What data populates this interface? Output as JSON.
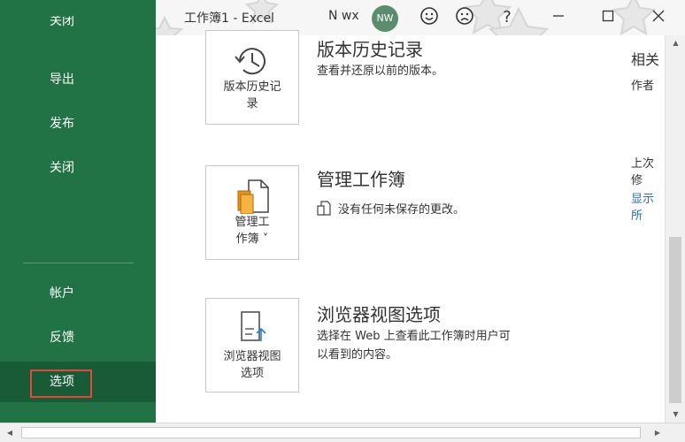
{
  "window": {
    "title": "工作簿1  -  Excel",
    "user_name": "N wx",
    "avatar_initials": "NW",
    "icons": [
      "smile-icon",
      "frown-icon",
      "help-icon",
      "minimize-icon",
      "maximize-icon",
      "close-icon"
    ],
    "help_label": "?"
  },
  "sidebar": {
    "partial_item": "关闭",
    "items": [
      {
        "label": "导出"
      },
      {
        "label": "发布"
      },
      {
        "label": "关闭"
      },
      {
        "label": "帐户"
      },
      {
        "label": "反馈"
      },
      {
        "label": "选项"
      }
    ],
    "accent": "#217346",
    "selected_bg": "#195a37",
    "highlight_box_color": "#e04a3a"
  },
  "main": {
    "sections": [
      {
        "card_label_1": "版本历史记",
        "card_label_2": "录",
        "title": "版本历史记录",
        "desc": "查看并还原以前的版本。"
      },
      {
        "card_label_1": "管理工",
        "card_label_2": "作簿 ˅",
        "title": "管理工作簿",
        "desc": "没有任何未保存的更改。"
      },
      {
        "card_label_1": "浏览器视图",
        "card_label_2": "选项",
        "title": "浏览器视图选项",
        "desc_line1": "选择在 Web 上查看此工作簿时用户可",
        "desc_line2": "以看到的内容。"
      }
    ],
    "right_panel": {
      "heading": "相关",
      "author_label": "作者",
      "last_modified_label": "上次修",
      "show_link": "显示所"
    }
  }
}
